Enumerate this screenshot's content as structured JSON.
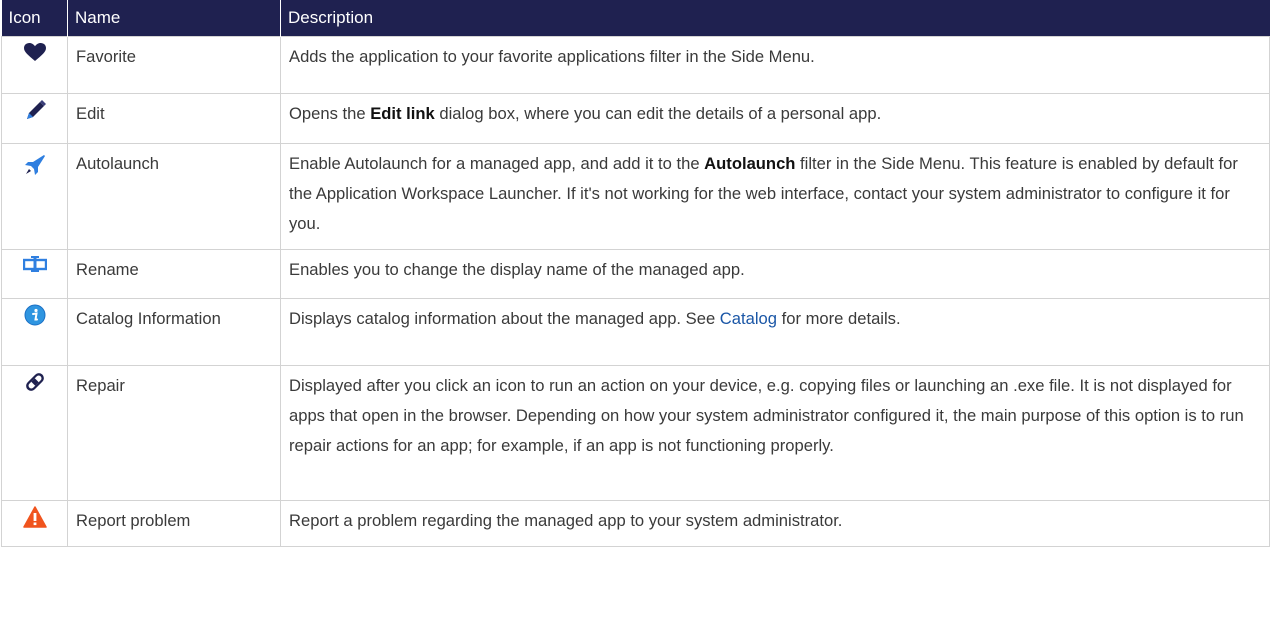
{
  "table": {
    "headers": {
      "icon": "Icon",
      "name": "Name",
      "description": "Description"
    },
    "rows": [
      {
        "icon": "heart-icon",
        "name": "Favorite",
        "description": "Adds the application to your favorite applications filter in the Side Menu."
      },
      {
        "icon": "pencil-icon",
        "name": "Edit",
        "desc_before": "Opens the ",
        "desc_strong": "Edit link",
        "desc_after": " dialog box, where you can edit the details of a personal app."
      },
      {
        "icon": "rocket-icon",
        "name": "Autolaunch",
        "desc_before": "Enable Autolaunch for a managed app, and add it to the ",
        "desc_strong": "Autolaunch",
        "desc_after": " filter in the Side Menu. This feature is enabled by default for the Application Workspace Launcher. If it's not working for the web interface, contact your system administrator to configure it for you."
      },
      {
        "icon": "rename-icon",
        "name": "Rename",
        "description": "Enables you to change the display name of the managed app."
      },
      {
        "icon": "info-icon",
        "name": "Catalog Information",
        "desc_before": "Displays catalog information about the managed app. See ",
        "desc_link": "Catalog",
        "desc_after": " for more details."
      },
      {
        "icon": "bandage-icon",
        "name": "Repair",
        "description": "Displayed after you click an icon to run an action on your device, e.g. copying files or launching an .exe file. It is not displayed for apps that open in the browser. Depending on how your system administrator configured it, the main purpose of this option is to run repair actions for an app; for example, if an app is not functioning properly."
      },
      {
        "icon": "warning-icon",
        "name": "Report problem",
        "description": "Report a problem regarding the managed app to your system administrator."
      }
    ]
  },
  "colors": {
    "header_bg": "#1f2150",
    "link": "#1a56a6",
    "icon_dark": "#1f2150",
    "icon_blue": "#2f7fe0",
    "icon_orange": "#f0541e"
  }
}
